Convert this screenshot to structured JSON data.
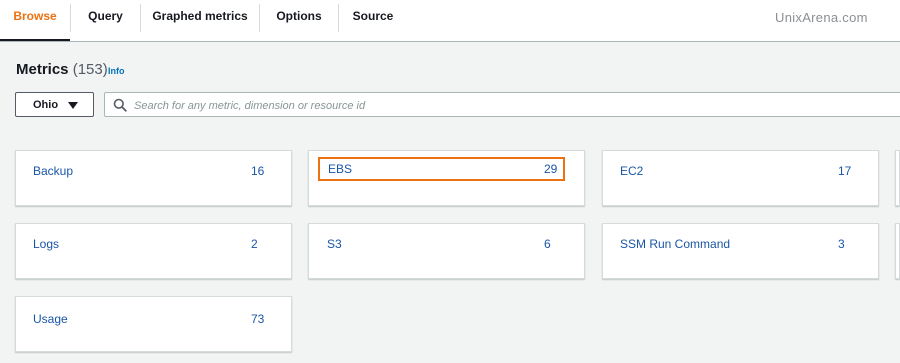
{
  "tabs": [
    {
      "label": "Browse",
      "active": true
    },
    {
      "label": "Query",
      "active": false
    },
    {
      "label": "Graphed metrics",
      "active": false
    },
    {
      "label": "Options",
      "active": false
    },
    {
      "label": "Source",
      "active": false
    }
  ],
  "watermark": "UnixArena.com",
  "header": {
    "title": "Metrics",
    "count": "(153)",
    "info": "Info"
  },
  "region": {
    "selected": "Ohio"
  },
  "search": {
    "placeholder": "Search for any metric, dimension or resource id",
    "value": ""
  },
  "namespaces": [
    {
      "name": "Backup",
      "count": "16",
      "highlighted": false
    },
    {
      "name": "EBS",
      "count": "29",
      "highlighted": true
    },
    {
      "name": "EC2",
      "count": "17",
      "highlighted": false
    },
    {
      "name": "Logs",
      "count": "2",
      "highlighted": false
    },
    {
      "name": "S3",
      "count": "6",
      "highlighted": false
    },
    {
      "name": "SSM Run Command",
      "count": "3",
      "highlighted": false
    },
    {
      "name": "Usage",
      "count": "73",
      "highlighted": false
    }
  ],
  "colors": {
    "accent": "#ec7211",
    "link": "#1a56a6",
    "info": "#0073bb"
  }
}
